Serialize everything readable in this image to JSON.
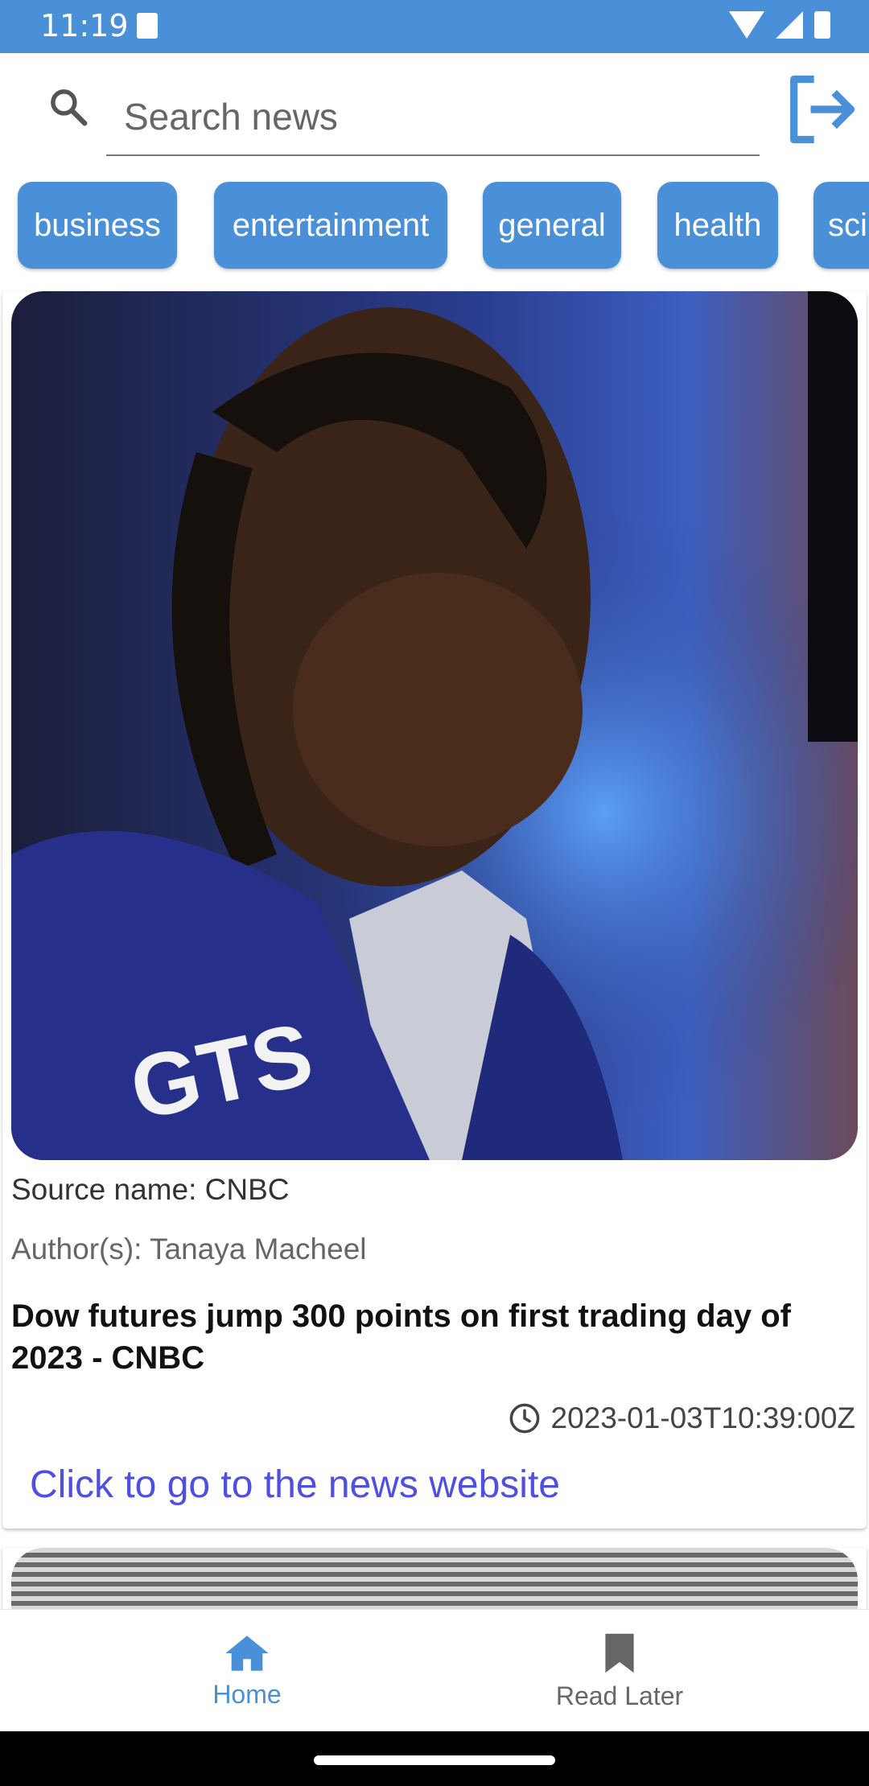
{
  "status_bar": {
    "time": "11:19"
  },
  "search": {
    "placeholder": "Search news"
  },
  "categories": [
    "business",
    "entertainment",
    "general",
    "health",
    "sci"
  ],
  "colors": {
    "accent": "#4a90d9",
    "link": "#5050e0"
  },
  "article": {
    "source_label": "Source name: CNBC",
    "author_label": "Author(s): Tanaya Macheel",
    "headline": "Dow futures jump 300 points on first trading day of 2023 - CNBC",
    "published_at": "2023-01-03T10:39:00Z",
    "link_text": "Click to go to the news website",
    "image_text": "GTS"
  },
  "bottom_nav": {
    "home": "Home",
    "read_later": "Read Later"
  }
}
